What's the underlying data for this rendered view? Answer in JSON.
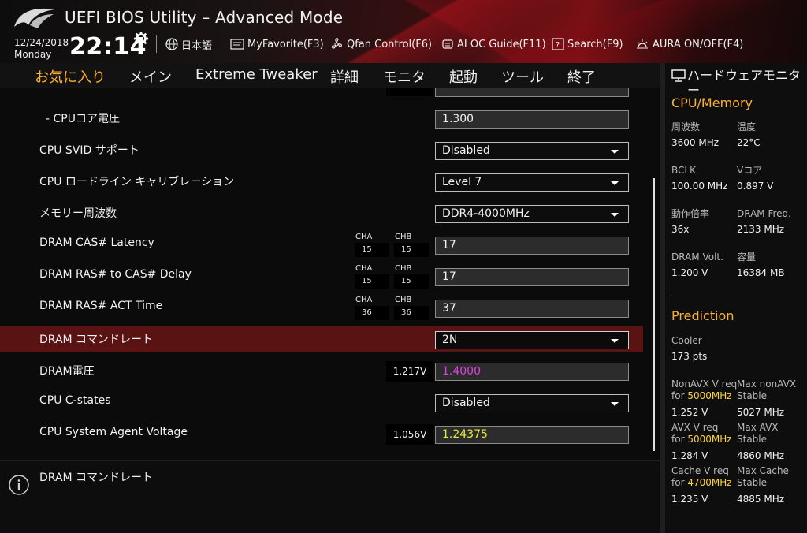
{
  "header": {
    "title": "UEFI BIOS Utility – Advanced Mode",
    "date": "12/24/2018",
    "weekday": "Monday",
    "time": "22:14",
    "tools": [
      {
        "label": "日本語",
        "icon": "globe-icon"
      },
      {
        "label": "MyFavorite(F3)",
        "icon": "myfavorite-icon"
      },
      {
        "label": "Qfan Control(F6)",
        "icon": "fan-icon"
      },
      {
        "label": "AI OC Guide(F11)",
        "icon": "ai-oc-guide-icon"
      },
      {
        "label": "Search(F9)",
        "icon": "search-icon"
      },
      {
        "label": "AURA ON/OFF(F4)",
        "icon": "aura-icon"
      }
    ]
  },
  "menu": {
    "tabs": [
      "お気に入り",
      "メイン",
      "Extreme Tweaker",
      "詳細",
      "モニタ",
      "起動",
      "ツール",
      "終了"
    ],
    "active_index": 0
  },
  "settings": {
    "rows": [
      {
        "label": "- CPUコア電圧",
        "value": "1.300"
      },
      {
        "label": "CPU SVID サポート",
        "value": "Disabled"
      },
      {
        "label": "CPU ロードライン キャリブレーション",
        "value": "Level 7"
      },
      {
        "label": "メモリー周波数",
        "value": "DDR4-4000MHz"
      },
      {
        "label": "DRAM CAS# Latency",
        "value": "17",
        "cha_label": "CHA",
        "cha": "15",
        "chb_label": "CHB",
        "chb": "15"
      },
      {
        "label": "DRAM RAS# to CAS# Delay",
        "value": "17",
        "cha_label": "CHA",
        "cha": "15",
        "chb_label": "CHB",
        "chb": "15"
      },
      {
        "label": "DRAM RAS# ACT Time",
        "value": "37",
        "cha_label": "CHA",
        "cha": "36",
        "chb_label": "CHB",
        "chb": "36"
      },
      {
        "label": "DRAM コマンドレート",
        "value": "2N"
      },
      {
        "label": "DRAM電圧",
        "value": "1.4000",
        "current": "1.217V"
      },
      {
        "label": "CPU C-states",
        "value": "Disabled"
      },
      {
        "label": "CPU System Agent Voltage",
        "value": "1.24375",
        "current": "1.056V"
      }
    ]
  },
  "help": {
    "text": "DRAM コマンドレート"
  },
  "hw_monitor": {
    "title": "ハードウェアモニター",
    "cpu_memory": {
      "title": "CPU/Memory",
      "items": [
        {
          "label": "周波数",
          "value": "3600 MHz"
        },
        {
          "label": "温度",
          "value": "22°C"
        },
        {
          "label": "BCLK",
          "value": "100.00 MHz"
        },
        {
          "label": "Vコア",
          "value": "0.897 V"
        },
        {
          "label": "動作倍率",
          "value": "36x"
        },
        {
          "label": "DRAM Freq.",
          "value": "2133 MHz"
        },
        {
          "label": "DRAM Volt.",
          "value": "1.200 V"
        },
        {
          "label": "容量",
          "value": "16384 MB"
        }
      ]
    },
    "prediction": {
      "title": "Prediction",
      "cooler_label": "Cooler",
      "cooler_value": "173 pts",
      "items": [
        {
          "label": "NonAVX V req",
          "label2": "for",
          "freq": "5000MHz",
          "value": "1.252 V"
        },
        {
          "label": "Max nonAVX",
          "label2": "Stable",
          "value": "5027 MHz"
        },
        {
          "label": "AVX V req",
          "label2": "for",
          "freq": "5000MHz",
          "value": "1.284 V"
        },
        {
          "label": "Max AVX",
          "label2": "Stable",
          "value": "4860 MHz"
        },
        {
          "label": "Cache V req",
          "label2": "for",
          "freq": "4700MHz",
          "value": "1.235 V"
        },
        {
          "label": "Max Cache",
          "label2": "Stable",
          "value": "4885 MHz"
        }
      ]
    }
  }
}
